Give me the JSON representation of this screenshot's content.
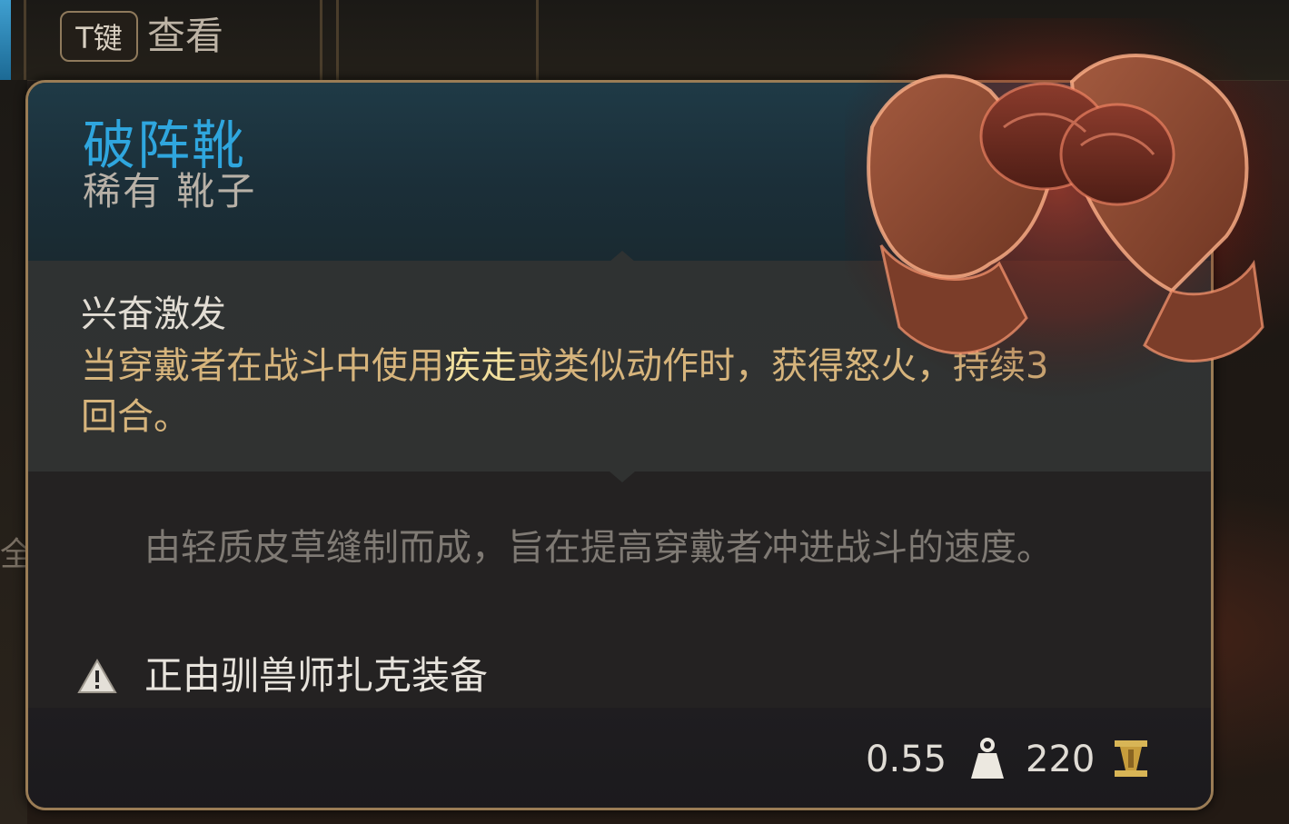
{
  "topbar": {
    "key_hint": "T键",
    "key_action": "查看",
    "left_glyph": "全"
  },
  "item": {
    "name": "破阵靴",
    "rarity_type": "稀有 靴子",
    "effect": {
      "name": "兴奋激发",
      "desc_before": "当穿戴者在战斗中使用",
      "keyword": "疾走",
      "desc_after": "或类似动作时，获得怒火，持续3回合。"
    },
    "lore": "由轻质皮草缝制而成，旨在提高穿戴者冲进战斗的速度。",
    "equipped_by": "正由驯兽师扎克装备",
    "weight": "0.55",
    "value": "220",
    "icons": {
      "warning": "warning-icon",
      "weight": "weight-icon",
      "gold": "gold-icon"
    }
  },
  "colors": {
    "name": "#2fa6de",
    "effect_desc": "#d6b47c",
    "keyword": "#f1df9e",
    "lore": "#7f7a74",
    "border": "#9a7c55"
  }
}
